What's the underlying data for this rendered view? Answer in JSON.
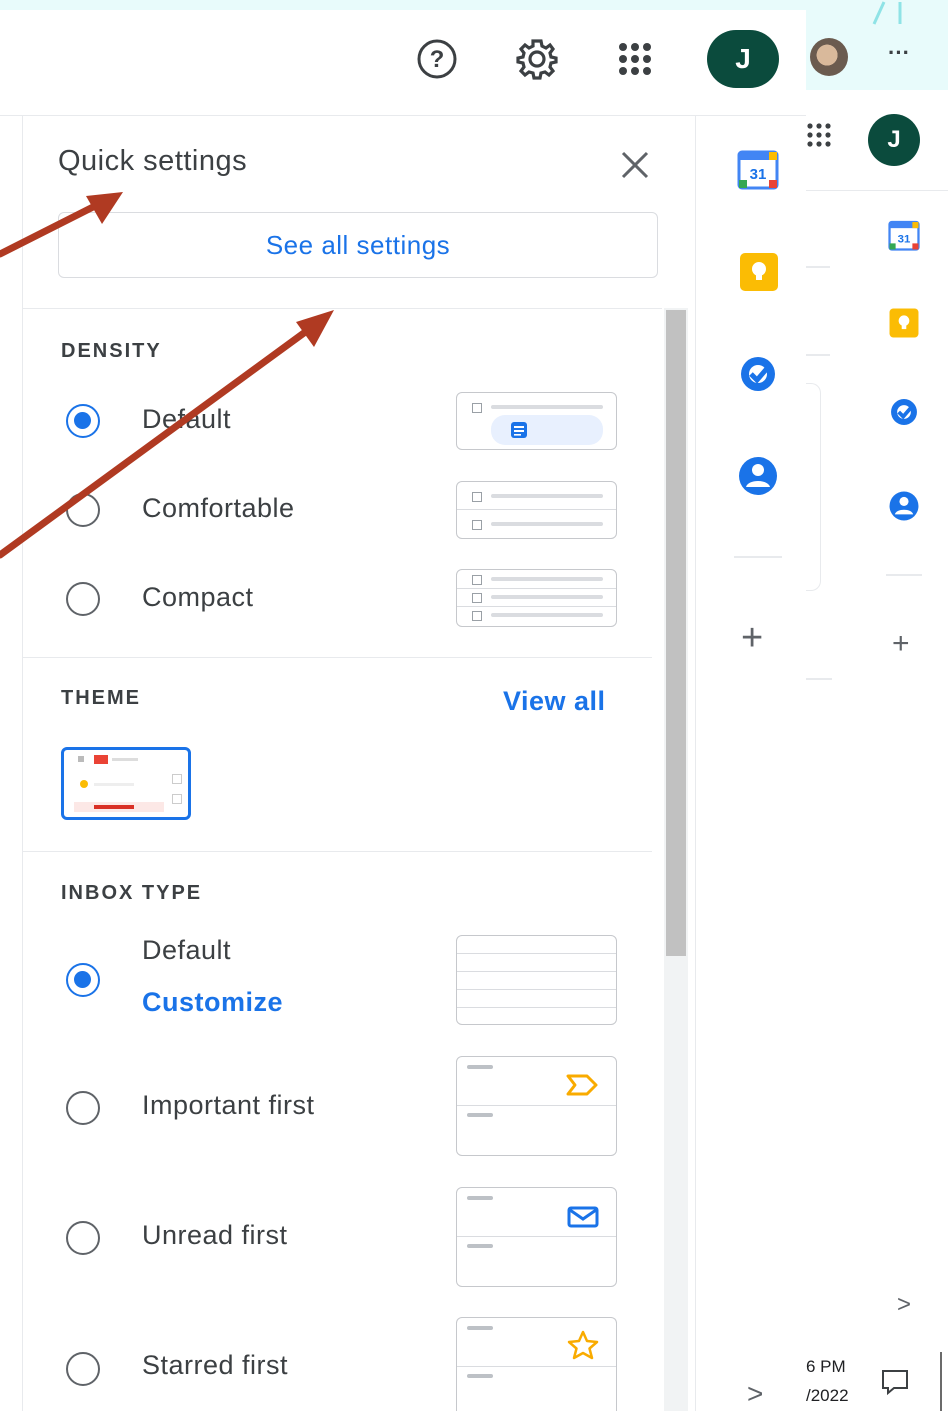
{
  "header": {
    "help_icon": "help-circle-icon",
    "settings_icon": "gear-icon",
    "apps_icon": "apps-grid-icon",
    "avatar_initial": "J",
    "more_label": "···",
    "second_avatar_initial": "J"
  },
  "quick_settings": {
    "title": "Quick settings",
    "see_all_label": "See all settings",
    "density": {
      "heading": "DENSITY",
      "options": [
        {
          "label": "Default",
          "selected": true
        },
        {
          "label": "Comfortable",
          "selected": false
        },
        {
          "label": "Compact",
          "selected": false
        }
      ]
    },
    "theme": {
      "heading": "THEME",
      "view_all": "View all"
    },
    "inbox_type": {
      "heading": "INBOX TYPE",
      "options": [
        {
          "label": "Default",
          "selected": true,
          "link": "Customize"
        },
        {
          "label": "Important first",
          "selected": false
        },
        {
          "label": "Unread first",
          "selected": false
        },
        {
          "label": "Starred first",
          "selected": false
        }
      ]
    }
  },
  "side_panel": {
    "calendar_date": "31",
    "add_label": "+",
    "expand_label": ">"
  },
  "taskbar": {
    "time": "6 PM",
    "date": "/2022"
  },
  "colors": {
    "accent": "#1a73e8",
    "avatar": "#0b4b3d",
    "annotation_arrow": "#b03a22"
  }
}
